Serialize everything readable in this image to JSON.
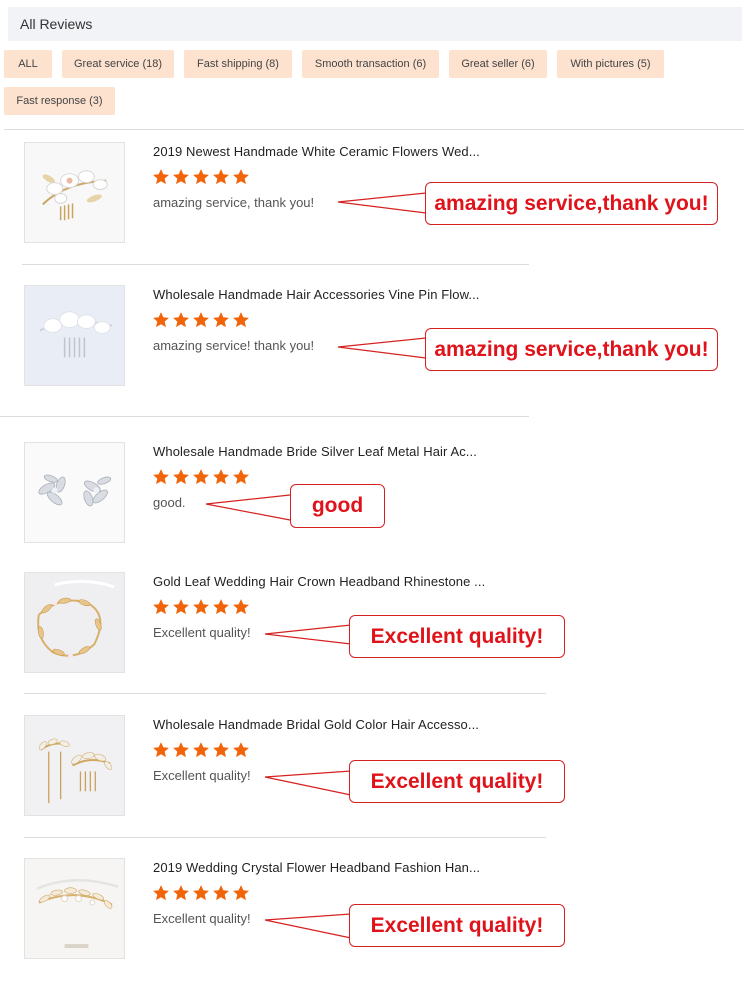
{
  "header": {
    "title": "All Reviews"
  },
  "tags": [
    {
      "label": "ALL"
    },
    {
      "label": "Great service (18)"
    },
    {
      "label": "Fast shipping (8)"
    },
    {
      "label": "Smooth transaction (6)"
    },
    {
      "label": "Great seller (6)"
    },
    {
      "label": "With pictures (5)"
    },
    {
      "label": "Fast response (3)"
    }
  ],
  "reviews": [
    {
      "title": "2019 Newest Handmade White Ceramic Flowers Wed...",
      "rating": 5,
      "comment": "amazing service, thank you!",
      "callout": "amazing service,thank you!",
      "image": "white-ceramic-flower-comb"
    },
    {
      "title": "Wholesale Handmade Hair Accessories Vine Pin Flow...",
      "rating": 5,
      "comment": "amazing service! thank you!",
      "callout": "amazing service,thank you!",
      "image": "vine-pin-flower-comb"
    },
    {
      "title": "Wholesale Handmade Bride Silver Leaf Metal Hair Ac...",
      "rating": 5,
      "comment": "good.",
      "callout": "good",
      "image": "silver-leaf-hair-clips"
    },
    {
      "title": "Gold Leaf Wedding Hair Crown Headband Rhinestone ...",
      "rating": 5,
      "comment": "Excellent quality!",
      "callout": "Excellent quality!",
      "image": "gold-leaf-headband"
    },
    {
      "title": "Wholesale Handmade Bridal Gold Color Hair Accesso...",
      "rating": 5,
      "comment": "Excellent quality!",
      "callout": "Excellent quality!",
      "image": "gold-hair-pins"
    },
    {
      "title": "2019 Wedding Crystal Flower Headband Fashion Han...",
      "rating": 5,
      "comment": "Excellent quality!",
      "callout": "Excellent quality!",
      "image": "crystal-flower-headband"
    }
  ],
  "colors": {
    "star": "#f2640a",
    "tag_bg": "#fde2cf",
    "callout_text": "#e0121a",
    "callout_border": "#d62121"
  }
}
